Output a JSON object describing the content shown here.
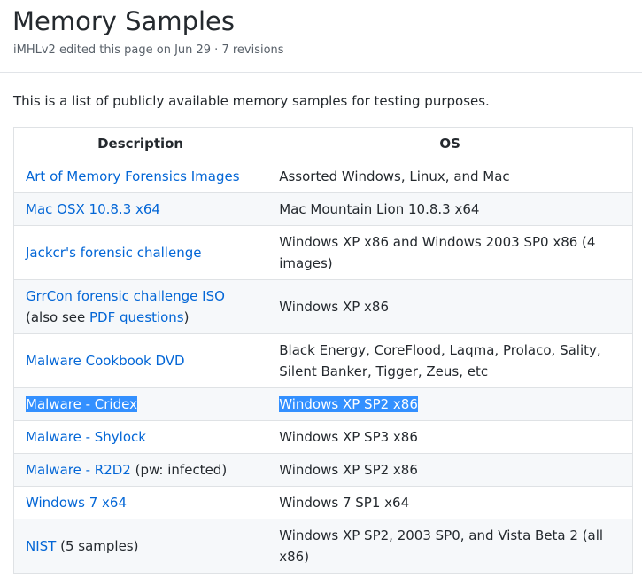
{
  "page": {
    "title": "Memory Samples",
    "meta": "iMHLv2 edited this page on Jun 29 · 7 revisions",
    "intro": "This is a list of publicly available memory samples for testing purposes."
  },
  "table": {
    "headers": [
      "Description",
      "OS"
    ],
    "rows": [
      {
        "link": "Art of Memory Forensics Images",
        "os": "Assorted Windows, Linux, and Mac"
      },
      {
        "link": "Mac OSX 10.8.3 x64",
        "os": "Mac Mountain Lion 10.8.3 x64"
      },
      {
        "link": "Jackcr's forensic challenge",
        "os": "Windows XP x86 and Windows 2003 SP0 x86 (4 images)"
      },
      {
        "link": "GrrCon forensic challenge ISO",
        "text_after": " (also see ",
        "link2": "PDF questions",
        "text_end": ")",
        "os": "Windows XP x86"
      },
      {
        "link": "Malware Cookbook DVD",
        "os": "Black Energy, CoreFlood, Laqma, Prolaco, Sality, Silent Banker, Tigger, Zeus, etc"
      },
      {
        "link": "Malware - Cridex",
        "os": "Windows XP SP2 x86",
        "selected": true
      },
      {
        "link": "Malware - Shylock",
        "os": "Windows XP SP3 x86"
      },
      {
        "link": "Malware - R2D2",
        "text_after": " (pw: infected)",
        "os": "Windows XP SP2 x86"
      },
      {
        "link": "Windows 7 x64",
        "os": "Windows 7 SP1 x64"
      },
      {
        "link": "NIST",
        "text_after": " (5 samples)",
        "os": "Windows XP SP2, 2003 SP0, and Vista Beta 2 (all x86)"
      }
    ]
  },
  "colors": {
    "link": "#0366d6",
    "selection": "#3390ff",
    "text": "#24292e",
    "muted": "#586069",
    "border": "#dfe2e5",
    "stripe": "#f6f8fa"
  }
}
